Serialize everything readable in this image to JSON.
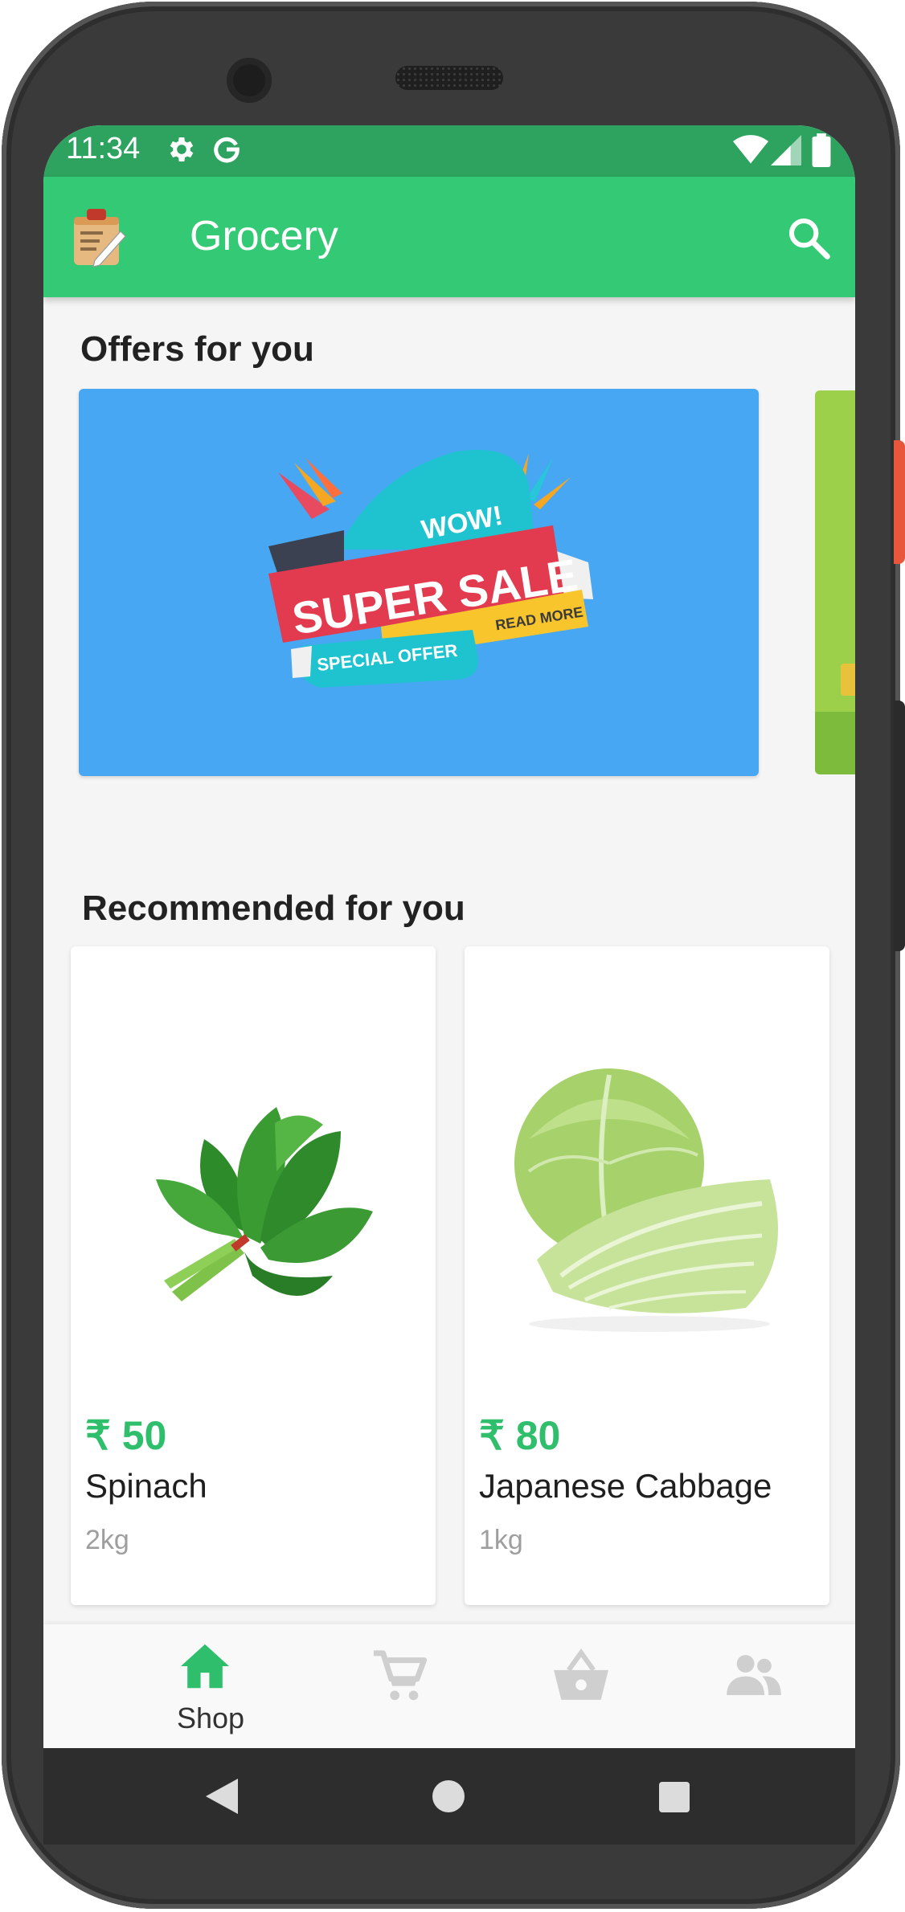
{
  "status_bar": {
    "time": "11:34",
    "icons": [
      "gear-icon",
      "google-g-icon",
      "wifi-icon",
      "signal-icon",
      "battery-icon"
    ]
  },
  "app_bar": {
    "title": "Grocery",
    "logo_icon": "notepad-icon",
    "search_icon": "search-icon"
  },
  "offers": {
    "title": "Offers for you",
    "banner": {
      "top_text": "WOW!",
      "main_text": "SUPER SALE",
      "ribbon_text": "READ MORE",
      "bottom_text": "SPECIAL OFFER"
    }
  },
  "recommended": {
    "title": "Recommended for you",
    "items": [
      {
        "price": "₹ 50",
        "name": "Spinach",
        "unit": "2kg"
      },
      {
        "price": "₹ 80",
        "name": "Japanese Cabbage",
        "unit": "1kg"
      }
    ]
  },
  "bottom_nav": {
    "items": [
      {
        "label": "Shop",
        "icon": "home-icon",
        "active": true
      },
      {
        "label": "",
        "icon": "cart-icon",
        "active": false
      },
      {
        "label": "",
        "icon": "basket-icon",
        "active": false
      },
      {
        "label": "",
        "icon": "people-icon",
        "active": false
      }
    ]
  },
  "colors": {
    "primary": "#33c975",
    "status_bar": "#2ea35f",
    "price": "#2fbf6c",
    "banner": "#47a7f2"
  }
}
